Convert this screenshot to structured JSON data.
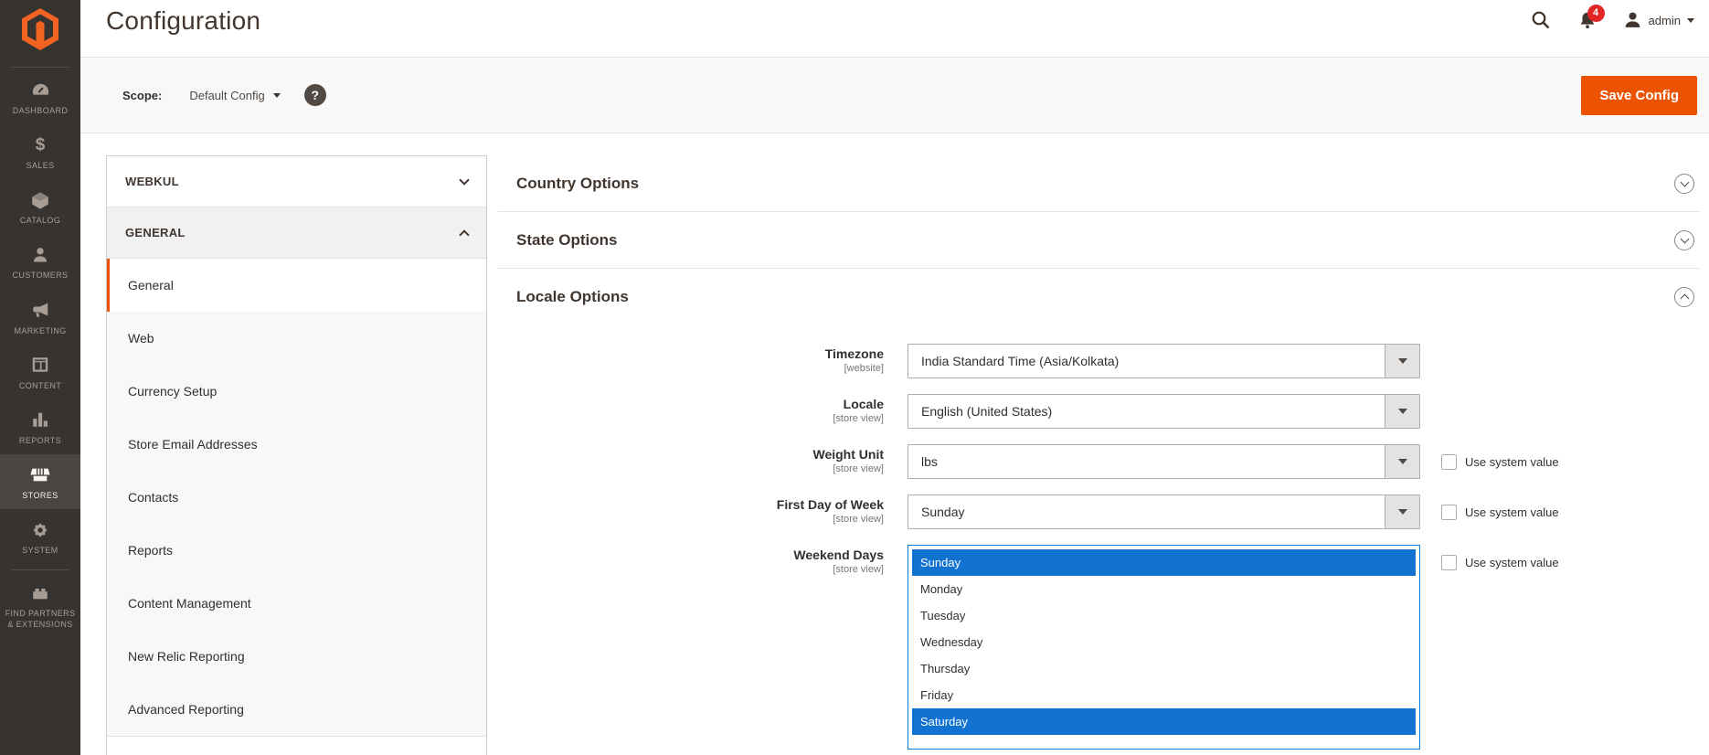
{
  "theme": {
    "accent_orange": "#eb5202",
    "logo_orange": "#f26322",
    "selection_blue": "#1272d2",
    "listbox_focus_border": "#007bdb",
    "sidebar_bg": "#373330",
    "sidebar_active_bg": "#4a4542",
    "badge_red": "#e22626",
    "heading_text": "#41362f"
  },
  "icons": {
    "logo": "magento-hexagon-monogram",
    "search": "magnifier",
    "notifications": "bell",
    "user": "person-silhouette",
    "help": "question-mark-in-dark-circle",
    "carets": "down-triangle",
    "group_collapse": "chevron-up / chevron-down",
    "section_collapse": "chevron-in-circle"
  },
  "sidebar": {
    "items": [
      {
        "label": "DASHBOARD",
        "icon": "dashboard-gauge",
        "active": false
      },
      {
        "label": "SALES",
        "icon": "dollar-sign",
        "active": false
      },
      {
        "label": "CATALOG",
        "icon": "package-box",
        "active": false
      },
      {
        "label": "CUSTOMERS",
        "icon": "person",
        "active": false
      },
      {
        "label": "MARKETING",
        "icon": "megaphone",
        "active": false
      },
      {
        "label": "CONTENT",
        "icon": "layout-frame",
        "active": false
      },
      {
        "label": "REPORTS",
        "icon": "bar-chart",
        "active": false
      },
      {
        "label": "STORES",
        "icon": "storefront-awning",
        "active": true
      },
      {
        "label": "SYSTEM",
        "icon": "gear",
        "active": false
      },
      {
        "label": "FIND PARTNERS & EXTENSIONS",
        "icon": "brick",
        "active": false
      }
    ]
  },
  "header": {
    "title": "Configuration",
    "notification_count": "4",
    "username": "admin"
  },
  "actions_bar": {
    "scope_label": "Scope:",
    "scope_value": "Default Config",
    "save_button_label": "Save Config"
  },
  "config_nav": {
    "groups": [
      {
        "label": "WEBKUL",
        "expanded": false
      },
      {
        "label": "GENERAL",
        "expanded": true
      }
    ],
    "items": [
      {
        "label": "General",
        "selected": true
      },
      {
        "label": "Web",
        "selected": false
      },
      {
        "label": "Currency Setup",
        "selected": false
      },
      {
        "label": "Store Email Addresses",
        "selected": false
      },
      {
        "label": "Contacts",
        "selected": false
      },
      {
        "label": "Reports",
        "selected": false
      },
      {
        "label": "Content Management",
        "selected": false
      },
      {
        "label": "New Relic Reporting",
        "selected": false
      },
      {
        "label": "Advanced Reporting",
        "selected": false
      }
    ]
  },
  "main": {
    "sections": [
      {
        "title": "Country Options",
        "expanded": false
      },
      {
        "title": "State Options",
        "expanded": false
      },
      {
        "title": "Locale Options",
        "expanded": true
      }
    ],
    "fields": [
      {
        "label": "Timezone",
        "scope": "[website]",
        "control": "select",
        "value": "India Standard Time (Asia/Kolkata)"
      },
      {
        "label": "Locale",
        "scope": "[store view]",
        "control": "select",
        "value": "English (United States)"
      },
      {
        "label": "Weight Unit",
        "scope": "[store view]",
        "control": "select",
        "value": "lbs",
        "checkbox_label": "Use system value",
        "checkbox_checked": false
      },
      {
        "label": "First Day of Week",
        "scope": "[store view]",
        "control": "select",
        "value": "Sunday",
        "checkbox_label": "Use system value",
        "checkbox_checked": false
      },
      {
        "label": "Weekend Days",
        "scope": "[store view]",
        "control": "multiselect",
        "options": [
          "Sunday",
          "Monday",
          "Tuesday",
          "Wednesday",
          "Thursday",
          "Friday",
          "Saturday"
        ],
        "selected_options": [
          "Sunday",
          "Saturday"
        ],
        "checkbox_label": "Use system value",
        "checkbox_checked": false
      }
    ]
  }
}
